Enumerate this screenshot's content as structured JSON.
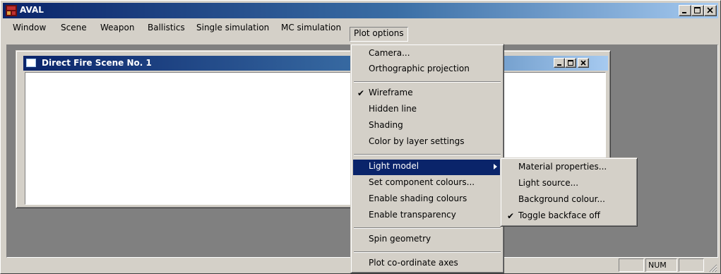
{
  "window": {
    "title": "AVAL"
  },
  "menubar": {
    "items": [
      "Window",
      "Scene",
      "Weapon",
      "Ballistics",
      "Single simulation",
      "MC simulation",
      "Plot options"
    ]
  },
  "child_window": {
    "title": "Direct Fire Scene No. 1"
  },
  "plot_menu": {
    "items": [
      "Camera...",
      "Orthographic projection",
      "Wireframe",
      "Hidden line",
      "Shading",
      "Color by layer settings",
      "Light model",
      "Set component colours...",
      "Enable shading colours",
      "Enable transparency",
      "Spin geometry",
      "Plot co-ordinate axes"
    ],
    "checked_item": "Wireframe",
    "highlighted_item": "Light model"
  },
  "light_submenu": {
    "items": [
      "Material properties...",
      "Light source...",
      "Background colour...",
      "Toggle backface off"
    ],
    "checked_item": "Toggle backface off"
  },
  "statusbar": {
    "num": "NUM"
  },
  "colors": {
    "titlebar_active": "#0a246a",
    "menu_highlight": "#0a246a",
    "face": "#d4d0c8"
  }
}
